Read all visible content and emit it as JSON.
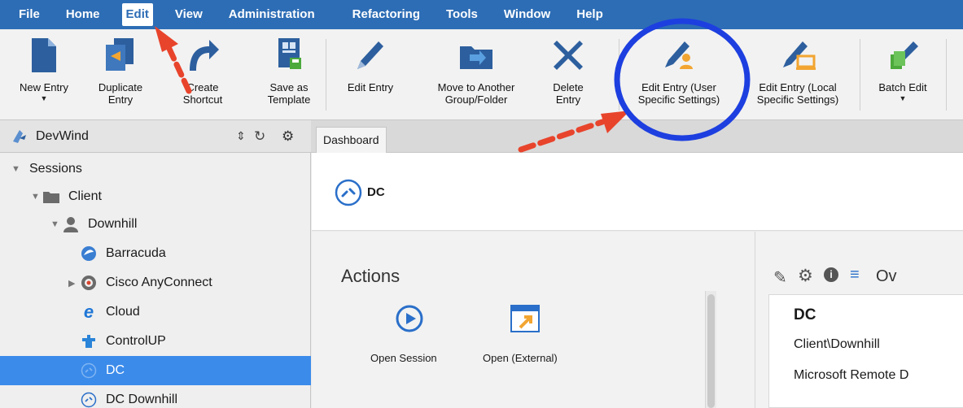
{
  "menu": {
    "items": [
      {
        "label": "File"
      },
      {
        "label": "Home"
      },
      {
        "label": "Edit",
        "active": true
      },
      {
        "label": "View"
      },
      {
        "label": "Administration"
      },
      {
        "label": "Refactoring"
      },
      {
        "label": "Tools"
      },
      {
        "label": "Window"
      },
      {
        "label": "Help"
      }
    ]
  },
  "ribbon": {
    "new_entry": "New Entry",
    "duplicate_entry": "Duplicate\nEntry",
    "create_shortcut": "Create\nShortcut",
    "save_as_template": "Save as\nTemplate",
    "edit_entry": "Edit Entry",
    "move_to_group": "Move to Another\nGroup/Folder",
    "delete_entry": "Delete\nEntry",
    "edit_entry_user": "Edit Entry (User\nSpecific Settings)",
    "edit_entry_local": "Edit Entry (Local\nSpecific Settings)",
    "batch_edit": "Batch Edit"
  },
  "sidebar": {
    "datasource": "DevWind",
    "tree": [
      {
        "label": "Sessions",
        "icon": "none",
        "expanded": true
      },
      {
        "label": "Client",
        "icon": "folder-icon",
        "expanded": true
      },
      {
        "label": "Downhill",
        "icon": "user-group-icon",
        "expanded": true
      },
      {
        "label": "Barracuda",
        "icon": "barracuda-icon"
      },
      {
        "label": "Cisco AnyConnect",
        "icon": "cisco-anyconnect-icon",
        "expanded": false
      },
      {
        "label": "Cloud",
        "icon": "internet-explorer-icon"
      },
      {
        "label": "ControlUP",
        "icon": "controlup-icon"
      },
      {
        "label": "DC",
        "icon": "rdp-icon",
        "selected": true
      },
      {
        "label": "DC Downhill",
        "icon": "rdp-icon"
      }
    ]
  },
  "tabs": {
    "dashboard": "Dashboard"
  },
  "entry": {
    "name": "DC"
  },
  "actions": {
    "title": "Actions",
    "open_session": "Open Session",
    "open_external": "Open (External)"
  },
  "overview": {
    "tab_partial": "Ov",
    "name": "DC",
    "path": "Client\\Downhill",
    "type_partial": "Microsoft Remote D"
  },
  "colors": {
    "menu_bg": "#2d6db5",
    "selection": "#3b8bea",
    "annotation_arrow": "#e8442c",
    "annotation_circle": "#1d3fe0"
  }
}
